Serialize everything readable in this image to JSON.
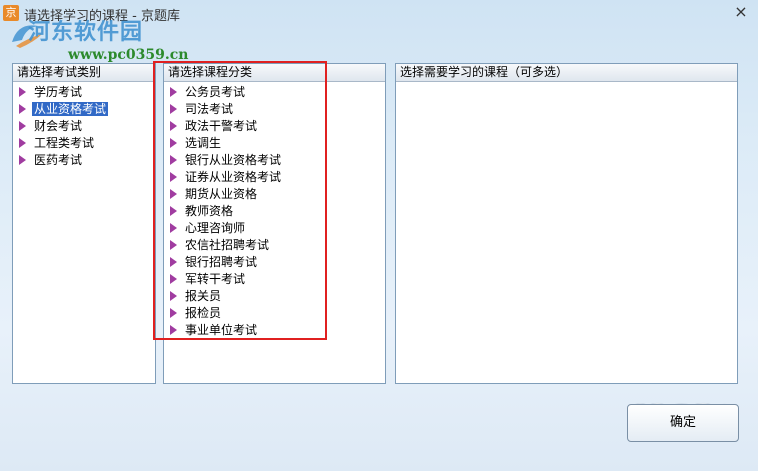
{
  "window": {
    "title": "请选择学习的课程 - 京题库",
    "app_icon": "京",
    "close_label": "×"
  },
  "watermark": {
    "text": "河东软件园",
    "url": "www.pc0359.cn"
  },
  "category_panel": {
    "header": "请选择考试类别",
    "items": [
      {
        "label": "学历考试",
        "selected": false
      },
      {
        "label": "从业资格考试",
        "selected": true
      },
      {
        "label": "财会考试",
        "selected": false
      },
      {
        "label": "工程类考试",
        "selected": false
      },
      {
        "label": "医药考试",
        "selected": false
      }
    ]
  },
  "course_panel": {
    "header": "请选择课程分类",
    "items": [
      {
        "label": "公务员考试"
      },
      {
        "label": "司法考试"
      },
      {
        "label": "政法干警考试"
      },
      {
        "label": "选调生"
      },
      {
        "label": "银行从业资格考试"
      },
      {
        "label": "证券从业资格考试"
      },
      {
        "label": "期货从业资格"
      },
      {
        "label": "教师资格"
      },
      {
        "label": "心理咨询师"
      },
      {
        "label": "农信社招聘考试"
      },
      {
        "label": "银行招聘考试"
      },
      {
        "label": "军转干考试"
      },
      {
        "label": "报关员"
      },
      {
        "label": "报检员"
      },
      {
        "label": "事业单位考试"
      }
    ]
  },
  "subject_panel": {
    "header": "选择需要学习的课程（可多选）",
    "items": []
  },
  "buttons": {
    "ok_label": "确定"
  },
  "colors": {
    "selection": "#3169c6",
    "bullet": "#a03ca0",
    "highlight_box": "#e02020"
  }
}
